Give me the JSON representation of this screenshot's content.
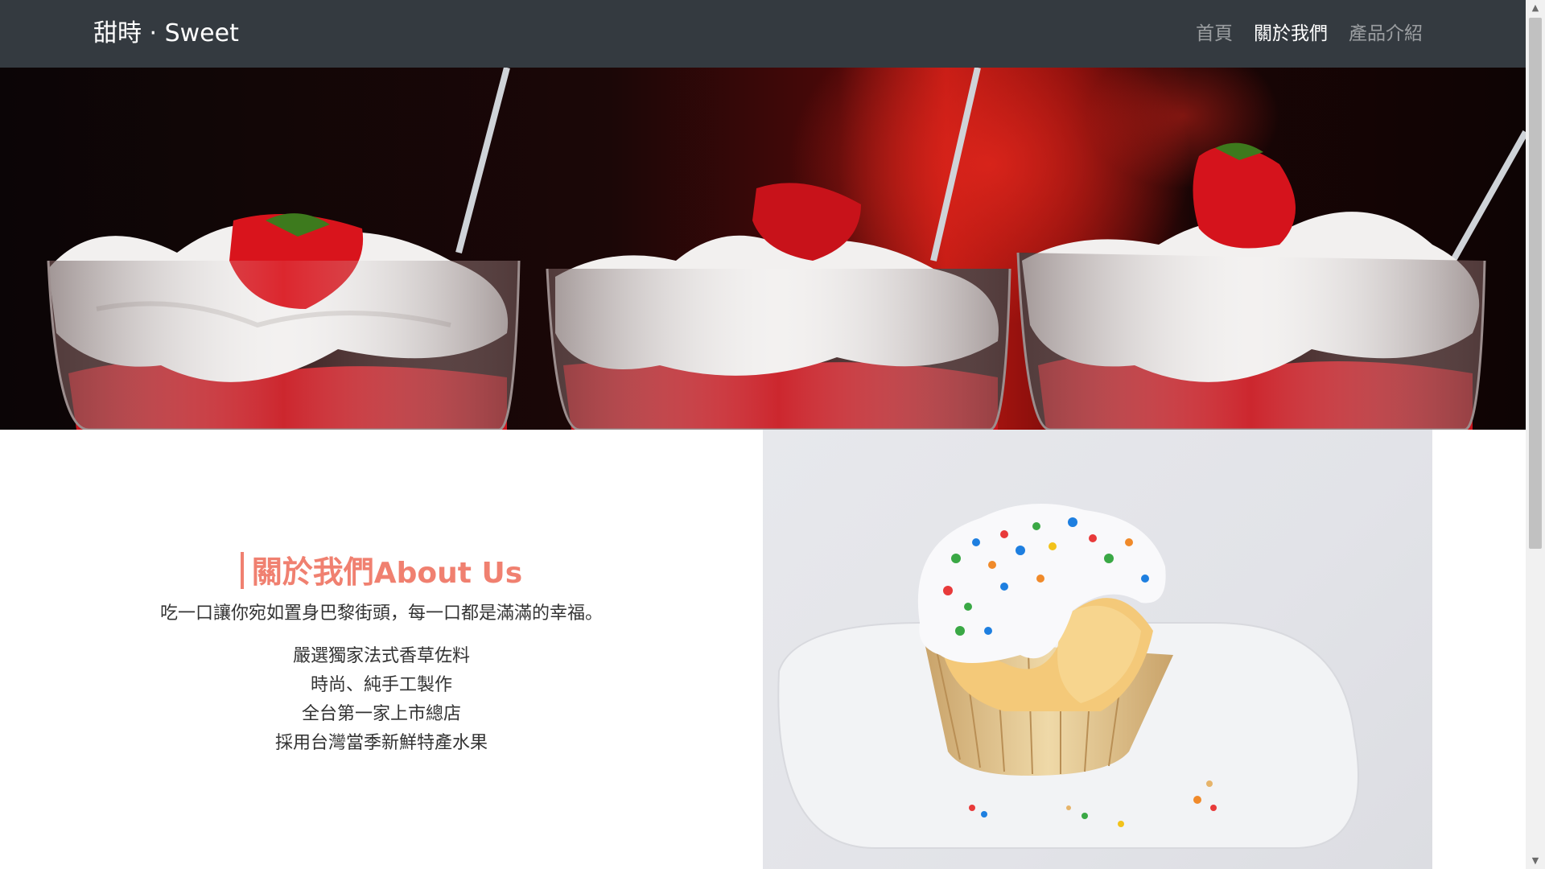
{
  "navbar": {
    "brand": "甜時 · Sweet",
    "links": [
      {
        "label": "首頁",
        "active": false
      },
      {
        "label": "關於我們",
        "active": true
      },
      {
        "label": "產品介紹",
        "active": false
      }
    ]
  },
  "about": {
    "heading_zh": "關於我們",
    "heading_en": "About Us",
    "description": "吃一口讓你宛如置身巴黎街頭，每一口都是滿滿的幸福。",
    "features": [
      "嚴選獨家法式香草佐料",
      "時尚、純手工製作",
      "全台第一家上市總店",
      "採用台灣當季新鮮特產水果"
    ]
  },
  "colors": {
    "navbar_bg": "#343a40",
    "accent": "#f08070",
    "text": "#333333"
  },
  "icons": {
    "scroll_up": "triangle-up-icon",
    "scroll_down": "triangle-down-icon"
  }
}
